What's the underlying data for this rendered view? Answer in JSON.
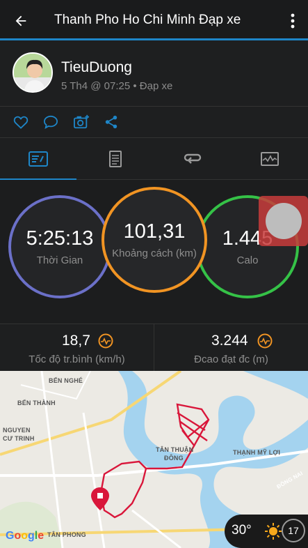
{
  "header": {
    "title": "Thanh Pho Ho Chi Minh Đạp xe",
    "back_icon": "back-arrow-icon",
    "more_icon": "more-vert-icon"
  },
  "profile": {
    "username": "TieuDuong",
    "subtitle": "5 Th4 @ 07:25 • Đạp xe"
  },
  "actions": [
    "heart-icon",
    "comment-icon",
    "add-photo-icon",
    "share-icon"
  ],
  "tabs": [
    "stats-tab",
    "details-tab",
    "laps-tab",
    "chart-tab"
  ],
  "rings": {
    "time": {
      "value": "5:25:13",
      "label": "Thời Gian",
      "color": "#6b70c8"
    },
    "distance": {
      "value": "101,31",
      "label": "Khoảng cách (km)",
      "color": "#f19423"
    },
    "calories": {
      "value": "1.445",
      "label": "Calo",
      "color": "#35c247"
    }
  },
  "metrics": {
    "avg_speed": {
      "value": "18,7",
      "label": "Tốc độ tr.bình (km/h)"
    },
    "elevation": {
      "value": "3.244",
      "label": "Đcao đạt đc (m)"
    }
  },
  "map": {
    "labels": {
      "ben_nghe": "BẾN NGHÉ",
      "ben_thanh": "BẾN THÀNH",
      "nguyen": "NGUYEN",
      "cu_trinh": "CƯ TRINH",
      "tan_thuan": "TÂN THUẬN",
      "dong": "ĐÔNG",
      "thanh_my_loi": "THẠNH MỸ LỢI",
      "tan_phong": "TÂN PHONG",
      "dong_nai": "ĐỒNG NAI"
    },
    "google": "Google",
    "temperature": "30°",
    "wind": "17",
    "route_color": "#d9163a",
    "water_color": "#a4d3ef"
  },
  "colors": {
    "accent": "#1e86c8",
    "icon": "#1e86c8"
  }
}
